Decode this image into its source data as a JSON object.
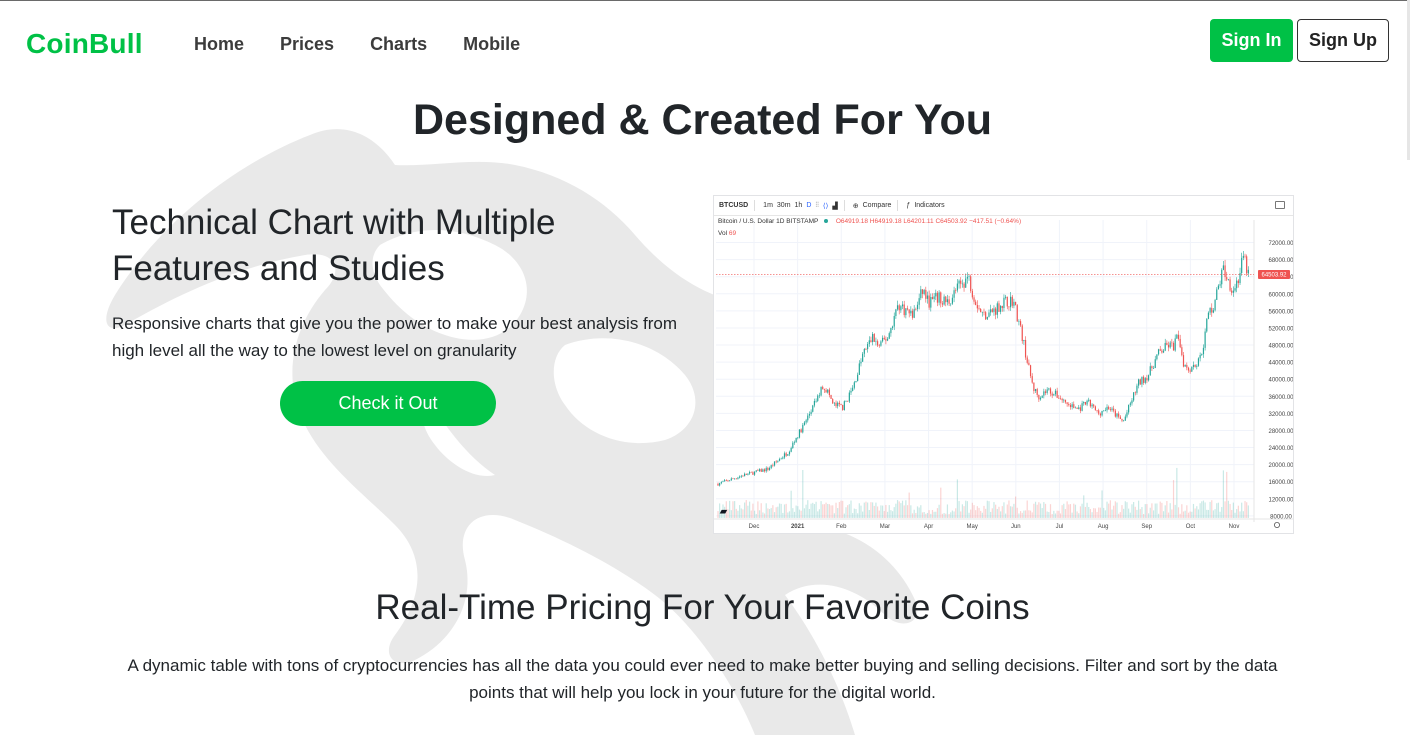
{
  "nav": {
    "brand": "CoinBull",
    "links": [
      "Home",
      "Prices",
      "Charts",
      "Mobile"
    ],
    "signin_label": "Sign In",
    "signup_label": "Sign Up"
  },
  "hero": {
    "title": "Designed & Created For You"
  },
  "feature": {
    "heading": "Technical Chart with Multiple Features and Studies",
    "description": "Responsive charts that give you the power to make your best analysis from high level all the way to the lowest level on granularity",
    "cta_label": "Check it Out"
  },
  "chart_widget": {
    "toolbar": {
      "symbol": "BTCUSD",
      "intervals": [
        "1m",
        "30m",
        "1h",
        "D"
      ],
      "active_interval": "D",
      "compare_label": "Compare",
      "indicators_label": "Indicators"
    },
    "legend": {
      "title": "Bitcoin / U.S. Dollar",
      "interval": "1D",
      "exchange": "BITSTAMP",
      "ohlc": "O64919.18 H64919.18 L64201.11 C64503.92 −417.51 (−0.64%)",
      "volume_label": "Vol",
      "volume_value": "69"
    },
    "last_price_label": "64503.92",
    "colors": {
      "up": "#26a69a",
      "down": "#ef5350",
      "grid": "#f0f3fa",
      "price_line": "#ef5350"
    }
  },
  "chart_data": {
    "type": "candlestick",
    "x_ticks": [
      "Dec",
      "2021",
      "Feb",
      "Mar",
      "Apr",
      "May",
      "Jun",
      "Jul",
      "Aug",
      "Sep",
      "Oct",
      "Nov"
    ],
    "y_ticks": [
      "72000.00",
      "68000.00",
      "64000.00",
      "60000.00",
      "56000.00",
      "52000.00",
      "48000.00",
      "44000.00",
      "40000.00",
      "36000.00",
      "32000.00",
      "28000.00",
      "24000.00",
      "20000.00",
      "16000.00",
      "12000.00",
      "8000.00"
    ],
    "ylim": [
      7500,
      74000
    ],
    "last_price": 64503.92,
    "path": [
      [
        0,
        15500
      ],
      [
        0.05,
        17500
      ],
      [
        0.1,
        19000
      ],
      [
        0.14,
        23000
      ],
      [
        0.17,
        29000
      ],
      [
        0.19,
        33500
      ],
      [
        0.21,
        38500
      ],
      [
        0.22,
        37000
      ],
      [
        0.23,
        34000
      ],
      [
        0.25,
        33500
      ],
      [
        0.27,
        38000
      ],
      [
        0.29,
        46000
      ],
      [
        0.31,
        50000
      ],
      [
        0.32,
        47500
      ],
      [
        0.34,
        50000
      ],
      [
        0.36,
        57500
      ],
      [
        0.37,
        56500
      ],
      [
        0.39,
        55000
      ],
      [
        0.41,
        61000
      ],
      [
        0.42,
        58000
      ],
      [
        0.44,
        59000
      ],
      [
        0.46,
        58000
      ],
      [
        0.48,
        61500
      ],
      [
        0.5,
        64000
      ],
      [
        0.51,
        60000
      ],
      [
        0.52,
        57000
      ],
      [
        0.53,
        55000
      ],
      [
        0.55,
        56000
      ],
      [
        0.57,
        58000
      ],
      [
        0.59,
        58500
      ],
      [
        0.6,
        54000
      ],
      [
        0.61,
        49000
      ],
      [
        0.62,
        43000
      ],
      [
        0.63,
        38000
      ],
      [
        0.64,
        36000
      ],
      [
        0.66,
        37500
      ],
      [
        0.68,
        36000
      ],
      [
        0.7,
        34000
      ],
      [
        0.72,
        33000
      ],
      [
        0.74,
        34500
      ],
      [
        0.76,
        32000
      ],
      [
        0.78,
        33500
      ],
      [
        0.8,
        31000
      ],
      [
        0.81,
        30000
      ],
      [
        0.82,
        33000
      ],
      [
        0.84,
        39000
      ],
      [
        0.86,
        41000
      ],
      [
        0.88,
        46000
      ],
      [
        0.9,
        48000
      ],
      [
        0.91,
        47500
      ],
      [
        0.92,
        50500
      ],
      [
        0.93,
        44000
      ],
      [
        0.94,
        42500
      ],
      [
        0.96,
        44000
      ],
      [
        0.97,
        48000
      ],
      [
        0.98,
        55500
      ],
      [
        0.99,
        57000
      ],
      [
        1.0,
        61500
      ],
      [
        1.01,
        66000
      ],
      [
        1.02,
        63000
      ],
      [
        1.03,
        61000
      ],
      [
        1.04,
        63500
      ],
      [
        1.05,
        68500
      ],
      [
        1.06,
        64500
      ]
    ]
  },
  "realtime": {
    "title": "Real-Time Pricing For Your Favorite Coins",
    "description": "A dynamic table with tons of cryptocurrencies has all the data you could ever need to make better buying and selling decisions. Filter and sort by the data points that will help you lock in your future for the digital world."
  },
  "decor": {
    "background_icon": "bull-logo-icon",
    "bull_color": "#e8e8e8"
  }
}
